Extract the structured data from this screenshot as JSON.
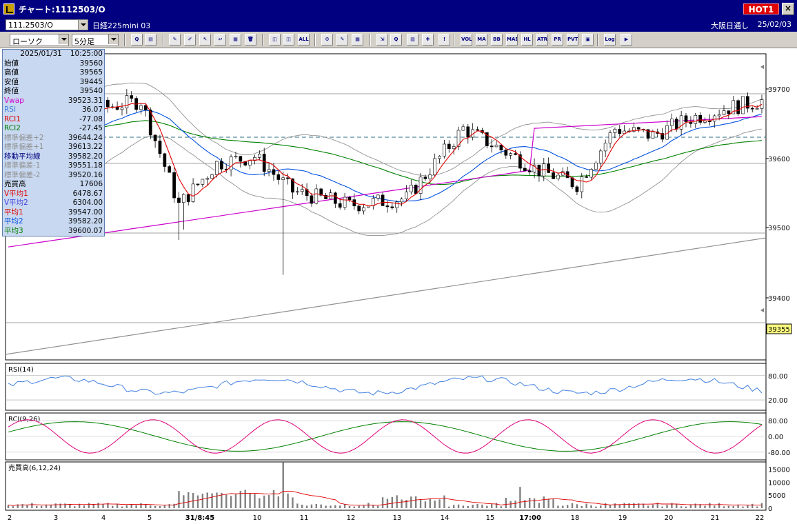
{
  "window": {
    "title": "チャート:1112503/O",
    "hot_badge": "HOT1",
    "close_glyph": "×"
  },
  "infobar": {
    "symbol": "111.2503/O",
    "instrument": "日経225mini 03",
    "session": "大阪日通し",
    "date": "25/02/03"
  },
  "toolbar": {
    "chart_type": "ローソク",
    "interval": "5分足",
    "button_labels": [
      "Q",
      "▤",
      "✎",
      "✐",
      "↖",
      "↩",
      "▦",
      "🗑",
      "◫",
      "◫",
      "ALL",
      "⚙",
      "✎",
      "▦",
      "⇲",
      "Q",
      "▥",
      "✚",
      "!",
      "VOL",
      "MA",
      "BB",
      "MAE",
      "HL",
      "ATR",
      "PR",
      "PVT",
      "▣",
      "Log",
      "▶"
    ]
  },
  "data_panel": {
    "datetime": [
      "2025/01/31",
      "10:25:00"
    ],
    "rows": [
      {
        "label": "始値",
        "value": "39560",
        "color": "#000000"
      },
      {
        "label": "高値",
        "value": "39565",
        "color": "#000000"
      },
      {
        "label": "安値",
        "value": "39445",
        "color": "#000000"
      },
      {
        "label": "終値",
        "value": "39540",
        "color": "#000000"
      },
      {
        "label": "Vwap",
        "value": "39523.31",
        "color": "#cc00cc"
      },
      {
        "label": "RSI",
        "value": "36.07",
        "color": "#4080e0"
      },
      {
        "label": "RCI1",
        "value": "-77.08",
        "color": "#e00000"
      },
      {
        "label": "RCI2",
        "value": "-27.45",
        "color": "#008000"
      },
      {
        "label": "標準偏差+2",
        "value": "39644.24",
        "color": "#909090"
      },
      {
        "label": "標準偏差+1",
        "value": "39613.22",
        "color": "#909090"
      },
      {
        "label": "移動平均線",
        "value": "39582.20",
        "color": "#000080"
      },
      {
        "label": "標準偏差-1",
        "value": "39551.18",
        "color": "#909090"
      },
      {
        "label": "標準偏差-2",
        "value": "39520.16",
        "color": "#909090"
      },
      {
        "label": "売買高",
        "value": "17606",
        "color": "#000000"
      },
      {
        "label": "V平均1",
        "value": "6478.67",
        "color": "#e00000"
      },
      {
        "label": "V平均2",
        "value": "6304.00",
        "color": "#4040e0"
      },
      {
        "label": "平均1",
        "value": "39547.00",
        "color": "#e00000"
      },
      {
        "label": "平均2",
        "value": "39582.20",
        "color": "#0050e0"
      },
      {
        "label": "平均3",
        "value": "39600.07",
        "color": "#008000"
      }
    ]
  },
  "main_chart": {
    "price_ticks": [
      "39700",
      "39600",
      "39500",
      "39400"
    ],
    "current_price": "39355",
    "x_labels": [
      "2",
      "3",
      "4",
      "5",
      "31/8:45",
      "10",
      "11",
      "12",
      "13",
      "14",
      "15",
      "17:00",
      "18",
      "19",
      "20",
      "21",
      "22"
    ]
  },
  "rsi_panel": {
    "label": "RSI(14)",
    "ticks": [
      "80.00",
      "20.00"
    ]
  },
  "rci_panel": {
    "label": "RCI(9,26)",
    "ticks": [
      "80.00",
      "0.00",
      "-80.00"
    ]
  },
  "volume_panel": {
    "label": "売買高(6,12,24)",
    "ticks": [
      "15000",
      "10000",
      "5000",
      "0"
    ]
  },
  "colors": {
    "titlebar": "#000080",
    "candle_up": "#ffffff",
    "candle_down": "#000000",
    "ma1": "#e00000",
    "ma2": "#0050e0",
    "ma3": "#008000",
    "vwap": "#cc00cc",
    "bands": "#909090",
    "current_price_bg": "#ffff80"
  }
}
